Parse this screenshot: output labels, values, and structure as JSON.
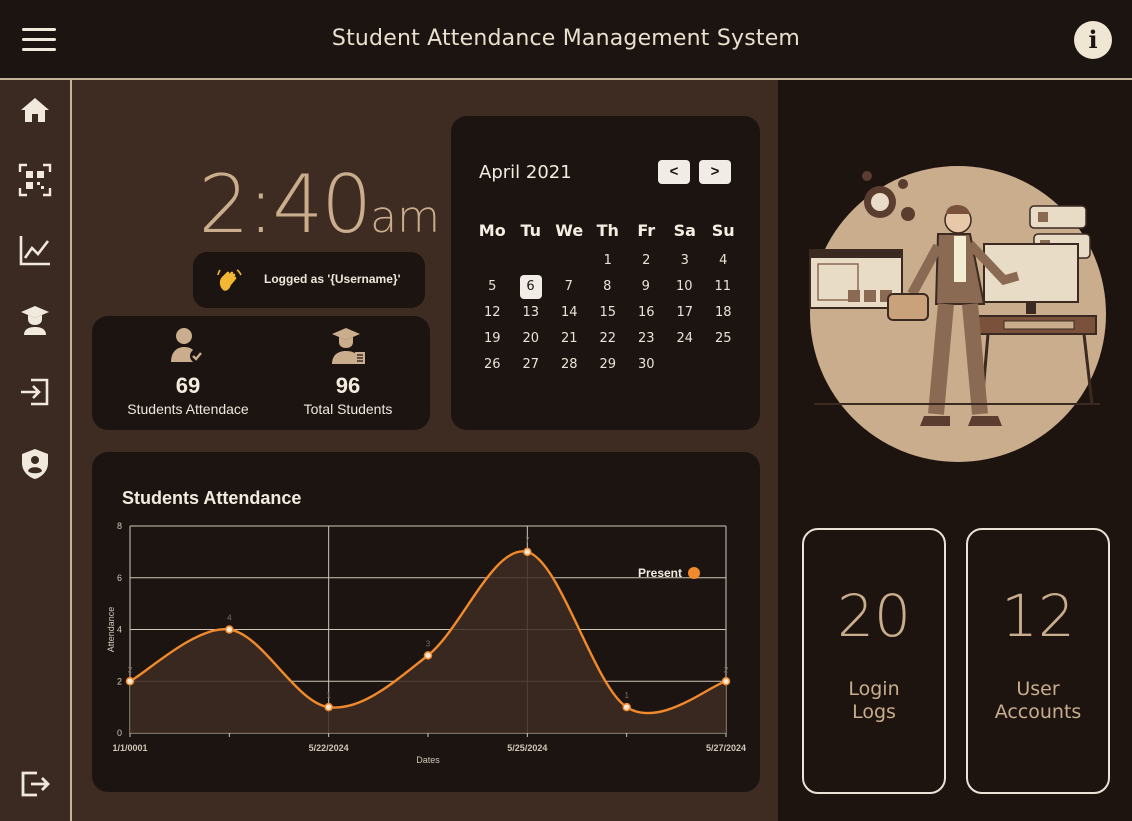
{
  "header": {
    "title": "Student Attendance Management System"
  },
  "clock": {
    "time": "2:40",
    "ampm": "am"
  },
  "user": {
    "logged_as": "Logged as '{Username}'"
  },
  "stats": {
    "attendance": {
      "value": "69",
      "label": "Students Attendace"
    },
    "total": {
      "value": "96",
      "label": "Total Students"
    }
  },
  "calendar": {
    "title": "April 2021",
    "prev_label": "<",
    "next_label": ">",
    "weekdays": [
      "Mo",
      "Tu",
      "We",
      "Th",
      "Fr",
      "Sa",
      "Su"
    ],
    "weeks": [
      [
        "",
        "",
        "",
        "1",
        "2",
        "3",
        "4"
      ],
      [
        "5",
        "6",
        "7",
        "8",
        "9",
        "10",
        "11"
      ],
      [
        "12",
        "13",
        "14",
        "15",
        "16",
        "17",
        "18"
      ],
      [
        "19",
        "20",
        "21",
        "22",
        "23",
        "24",
        "25"
      ],
      [
        "26",
        "27",
        "28",
        "29",
        "30",
        "",
        ""
      ]
    ],
    "selected_day": "6"
  },
  "chart": {
    "title": "Students Attendance"
  },
  "chart_data": {
    "type": "line",
    "title": "Students Attendance",
    "xlabel": "Dates",
    "ylabel": "Attendance",
    "x": [
      "1/1/0001",
      "",
      "5/22/2024",
      "",
      "5/25/2024",
      "",
      "5/27/2024"
    ],
    "x_tick_labels": [
      "1/1/0001",
      "5/22/2024",
      "5/25/2024",
      "5/27/2024"
    ],
    "series": [
      {
        "name": "Present",
        "values": [
          2,
          4,
          1,
          3,
          7,
          1,
          2
        ],
        "color": "#f08a2c"
      }
    ],
    "ylim": [
      0,
      8
    ],
    "y_ticks": [
      0,
      2,
      4,
      6,
      8
    ],
    "grid": true,
    "legend": "top-right"
  },
  "cards": {
    "login": {
      "value": "20",
      "label": "Login Logs"
    },
    "accounts": {
      "value": "12",
      "label": "User Accounts"
    }
  },
  "icons": [
    "menu-icon",
    "info-icon",
    "home-icon",
    "qr-code-icon",
    "chart-icon",
    "graduate-icon",
    "sign-in-icon",
    "shield-user-icon",
    "logout-icon"
  ],
  "colors": {
    "accent": "#c9ad8c",
    "line": "#f08a2c",
    "card": "#1c1411",
    "panel": "#3e2b22"
  }
}
